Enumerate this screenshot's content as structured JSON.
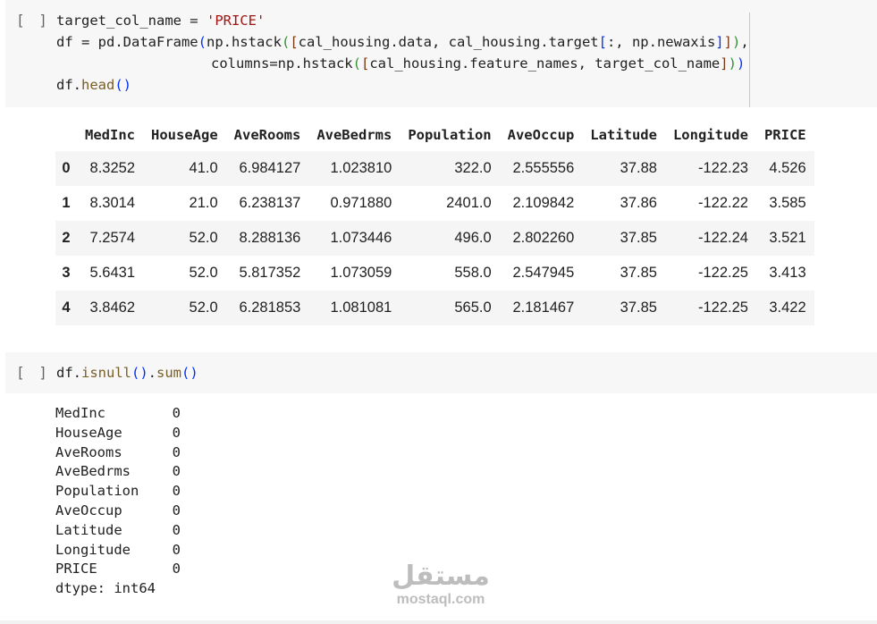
{
  "cell1": {
    "run_label": "[ ]",
    "lines": [
      {
        "p1": "target_col_name = ",
        "s1": "'PRICE'"
      },
      {
        "p1": "df = pd.DataFrame",
        "b1": "(",
        "p2": "np.hstack",
        "b2": "(",
        "b3": "[",
        "p3": "cal_housing.data, cal_housing.target",
        "b4": "[",
        "p4": ":, np.newaxis",
        "b5": "]",
        "b6": "]",
        "b7": ")",
        "p5": ","
      },
      {
        "p1": "columns=np.hstack",
        "b2": "(",
        "b3": "[",
        "p3": "cal_housing.feature_names, target_col_name",
        "b5": "]",
        "b6": ")",
        "b7": ")"
      },
      {
        "p1": "df.",
        "fn": "head",
        "b1": "()"
      }
    ]
  },
  "table": {
    "columns": [
      "MedInc",
      "HouseAge",
      "AveRooms",
      "AveBedrms",
      "Population",
      "AveOccup",
      "Latitude",
      "Longitude",
      "PRICE"
    ],
    "rows": [
      {
        "index": "0",
        "values": [
          "8.3252",
          "41.0",
          "6.984127",
          "1.023810",
          "322.0",
          "2.555556",
          "37.88",
          "-122.23",
          "4.526"
        ]
      },
      {
        "index": "1",
        "values": [
          "8.3014",
          "21.0",
          "6.238137",
          "0.971880",
          "2401.0",
          "2.109842",
          "37.86",
          "-122.22",
          "3.585"
        ]
      },
      {
        "index": "2",
        "values": [
          "7.2574",
          "52.0",
          "8.288136",
          "1.073446",
          "496.0",
          "2.802260",
          "37.85",
          "-122.24",
          "3.521"
        ]
      },
      {
        "index": "3",
        "values": [
          "5.6431",
          "52.0",
          "5.817352",
          "1.073059",
          "558.0",
          "2.547945",
          "37.85",
          "-122.25",
          "3.413"
        ]
      },
      {
        "index": "4",
        "values": [
          "3.8462",
          "52.0",
          "6.281853",
          "1.081081",
          "565.0",
          "2.181467",
          "37.85",
          "-122.25",
          "3.422"
        ]
      }
    ]
  },
  "cell2": {
    "run_label": "[ ]",
    "code_p1": "df.",
    "code_fn1": "isnull",
    "code_b1": "()",
    "code_p2": ".",
    "code_fn2": "sum",
    "code_b2": "()"
  },
  "output": {
    "lines": [
      "MedInc        0",
      "HouseAge      0",
      "AveRooms      0",
      "AveBedrms     0",
      "Population    0",
      "AveOccup      0",
      "Latitude      0",
      "Longitude     0",
      "PRICE         0",
      "dtype: int64"
    ]
  },
  "watermark": {
    "logo": "مستقل",
    "url": "mostaql.com"
  }
}
